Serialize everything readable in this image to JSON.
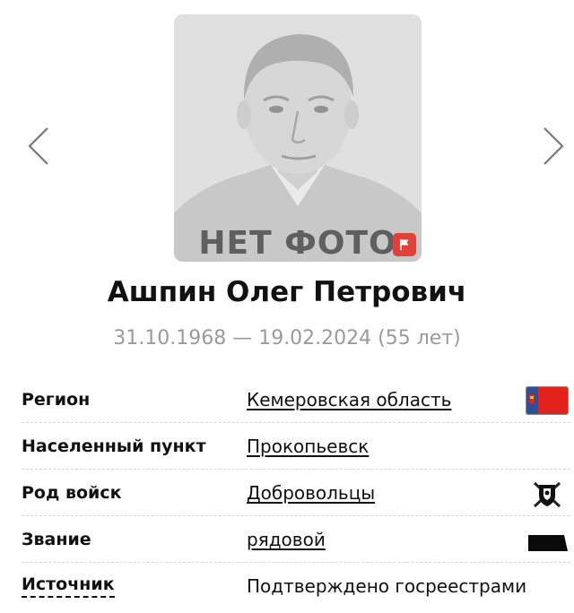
{
  "person": {
    "photo_caption": "НЕТ ФОТО",
    "name": "Ашпин Олег Петрович",
    "dates": "31.10.1968 — 19.02.2024 (55 лет)"
  },
  "details": [
    {
      "label": "Регион",
      "value": "Кемеровская область",
      "icon": "kemerovo-region-flag-icon"
    },
    {
      "label": "Населенный пункт",
      "value": "Прокопьевск"
    },
    {
      "label": "Род войск",
      "value": "Добровольцы",
      "icon": "volunteers-emblem-icon"
    },
    {
      "label": "Звание",
      "value": "рядовой",
      "icon": "rank-insignia-icon"
    },
    {
      "label": "Источник",
      "value": "Подтверждено госреестрами"
    }
  ],
  "colors": {
    "accent": "#e2403b",
    "muted_text": "#9a9a9a",
    "flag_red": "#e3231b",
    "flag_blue": "#2a4f9c"
  }
}
